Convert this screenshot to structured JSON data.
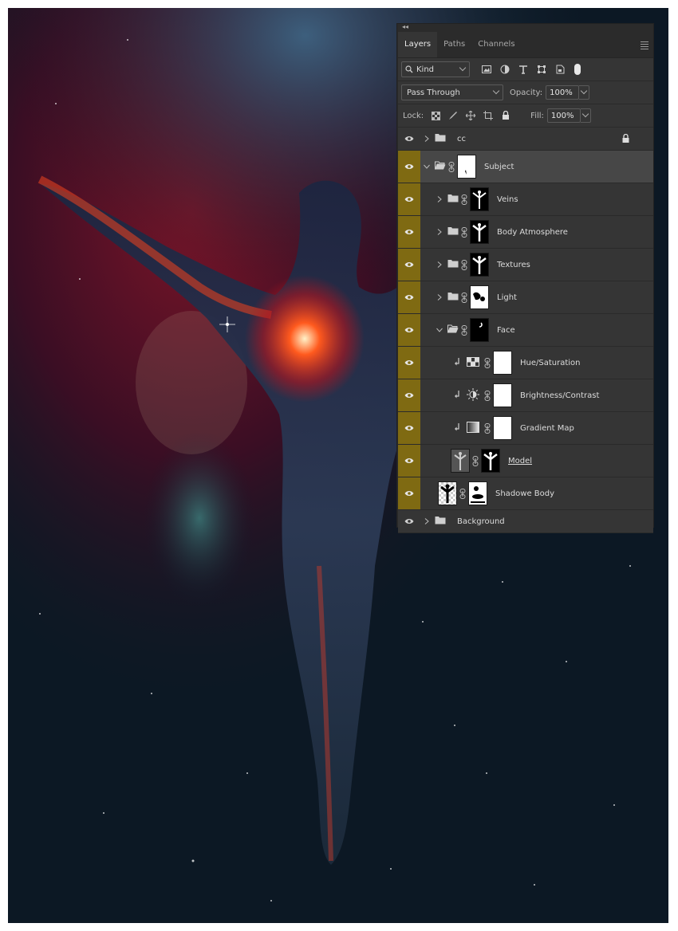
{
  "panel": {
    "tabs": [
      {
        "label": "Layers",
        "active": true
      },
      {
        "label": "Paths",
        "active": false
      },
      {
        "label": "Channels",
        "active": false
      }
    ],
    "filter": {
      "kind_label": "Kind"
    },
    "blend_mode": "Pass Through",
    "opacity": {
      "label": "Opacity:",
      "value": "100%"
    },
    "lock": {
      "label": "Lock:"
    },
    "fill": {
      "label": "Fill:",
      "value": "100%"
    }
  },
  "layers": [
    {
      "name": "cc",
      "type": "group",
      "visible": true,
      "locked": true,
      "expanded": false
    },
    {
      "name": "Subject",
      "type": "group",
      "visible": true,
      "expanded": true,
      "selected": true
    },
    {
      "name": "Veins",
      "type": "group",
      "visible": true,
      "expanded": false
    },
    {
      "name": "Body Atmosphere",
      "type": "group",
      "visible": true,
      "expanded": false
    },
    {
      "name": "Textures",
      "type": "group",
      "visible": true,
      "expanded": false
    },
    {
      "name": "Light",
      "type": "group",
      "visible": true,
      "expanded": false
    },
    {
      "name": "Face",
      "type": "group",
      "visible": true,
      "expanded": true
    },
    {
      "name": "Hue/Saturation",
      "type": "adjustment",
      "visible": true,
      "clipped": true
    },
    {
      "name": "Brightness/Contrast",
      "type": "adjustment",
      "visible": true,
      "clipped": true
    },
    {
      "name": "Gradient Map",
      "type": "adjustment",
      "visible": true,
      "clipped": true
    },
    {
      "name": "Model",
      "type": "pixel",
      "visible": true
    },
    {
      "name": "Shadowe Body",
      "type": "pixel",
      "visible": true
    },
    {
      "name": "Background",
      "type": "group",
      "visible": true,
      "expanded": false
    }
  ],
  "colors": {
    "panel_bg": "#353535",
    "visibility_highlight": "#7f6a12",
    "selected_row": "#474747"
  }
}
